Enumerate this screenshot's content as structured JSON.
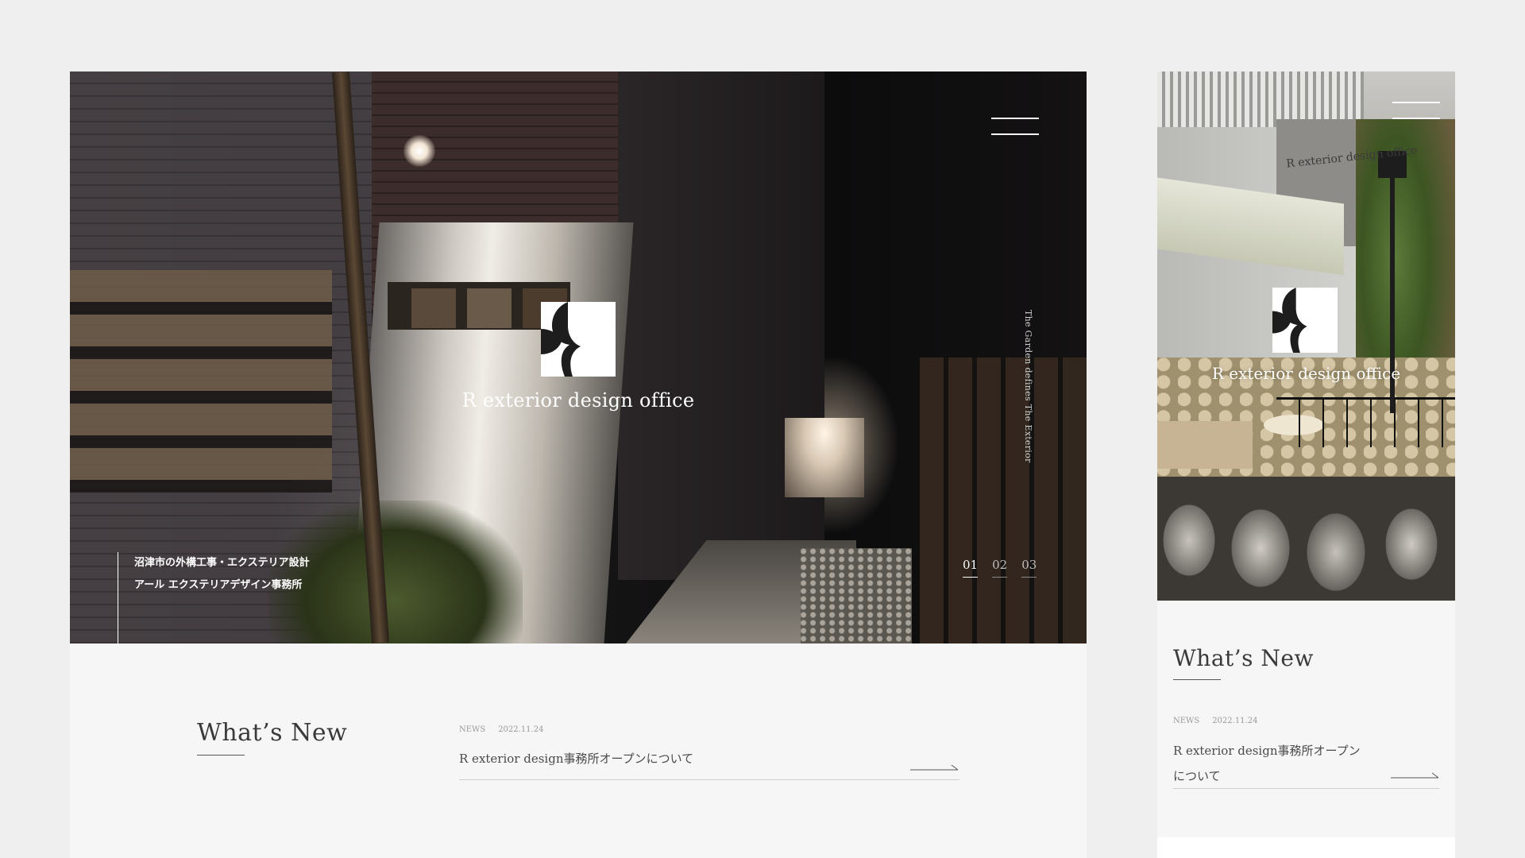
{
  "desktop": {
    "hero": {
      "brand": "R exterior design office",
      "tagline": "The Garden defines The Exterior",
      "caption_lines": [
        "沼津市の外構工事・エクステリア設計",
        "アール エクステリアデザイン事務所"
      ],
      "slides": [
        "01",
        "02",
        "03"
      ],
      "active_slide": "01"
    },
    "news": {
      "title": "What’s New",
      "category": "NEWS",
      "date": "2022.11.24",
      "headline": "R exterior design事務所オープンについて"
    }
  },
  "mobile": {
    "hero": {
      "brand": "R exterior design office",
      "sign_text": "R exterior design office"
    },
    "news": {
      "title": "What’s New",
      "category": "NEWS",
      "date": "2022.11.24",
      "headline": "R exterior design事務所オープンについて"
    }
  },
  "icons": {
    "menu": "hamburger-menu-icon",
    "logo": "r-logo-icon",
    "arrow": "arrow-right-icon"
  },
  "colors": {
    "page_bg": "#efefef",
    "panel_bg": "#f6f6f6",
    "text": "#3a3a3a",
    "muted": "#9a9a9a",
    "white": "#ffffff"
  }
}
